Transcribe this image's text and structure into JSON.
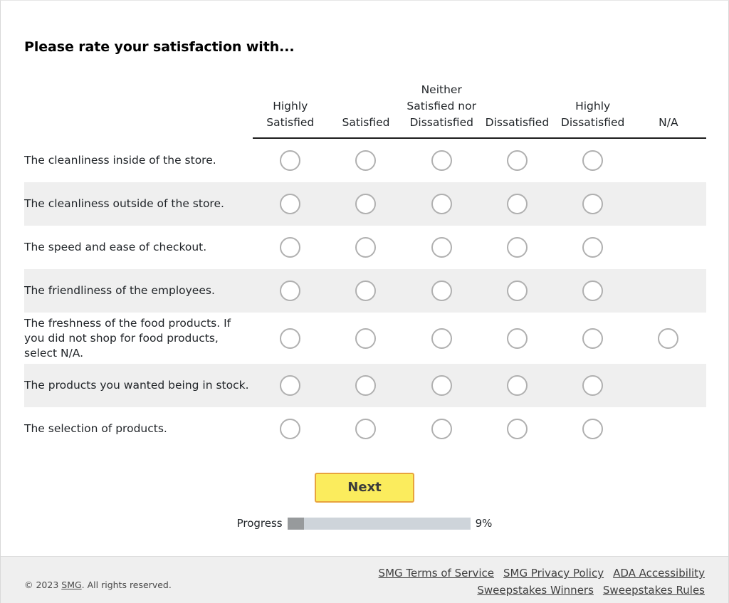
{
  "survey": {
    "title": "Please rate your satisfaction with...",
    "columns": [
      "Highly Satisfied",
      "Satisfied",
      "Neither Satisfied nor Dissatisfied",
      "Dissatisfied",
      "Highly Dissatisfied",
      "N/A"
    ],
    "rows": [
      {
        "label": "The cleanliness inside of the store.",
        "has_na": false,
        "striped": false
      },
      {
        "label": "The cleanliness outside of the store.",
        "has_na": false,
        "striped": true
      },
      {
        "label": "The speed and ease of checkout.",
        "has_na": false,
        "striped": false
      },
      {
        "label": "The friendliness of the employees.",
        "has_na": false,
        "striped": true
      },
      {
        "label": "The freshness of the food products. If you did not shop for food products, select N/A.",
        "has_na": true,
        "striped": false
      },
      {
        "label": "The products you wanted being in stock.",
        "has_na": false,
        "striped": true
      },
      {
        "label": "The selection of products.",
        "has_na": false,
        "striped": false
      }
    ]
  },
  "actions": {
    "next_label": "Next"
  },
  "progress": {
    "label": "Progress",
    "percent_text": "9%",
    "percent_value": 9,
    "fill_color": "#979a9c",
    "track_color": "#ced4da"
  },
  "footer": {
    "copyright_prefix": "© 2023 ",
    "copyright_link": "SMG",
    "copyright_suffix": ". All rights reserved.",
    "links_row1": [
      "SMG Terms of Service",
      "SMG Privacy Policy",
      "ADA Accessibility"
    ],
    "links_row2": [
      "Sweepstakes Winners",
      "Sweepstakes Rules"
    ]
  },
  "theme": {
    "button_fill": "#fbec5d",
    "button_border": "#e8a33d",
    "stripe": "#efefef",
    "radio_border": "#b0b0b0"
  }
}
